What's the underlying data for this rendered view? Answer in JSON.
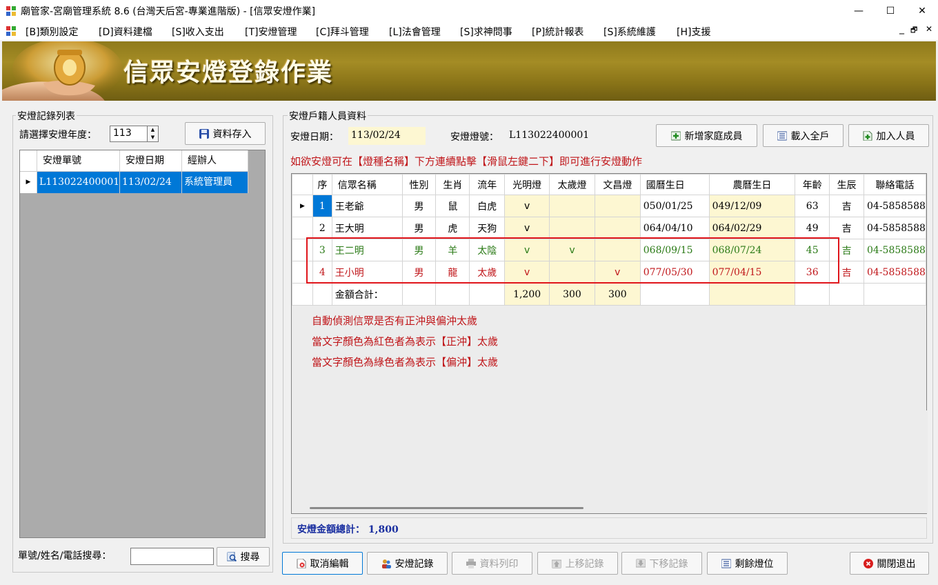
{
  "window": {
    "title": "廟管家-宮廟管理系統 8.6 (台灣天后宮-專業進階版) - [信眾安燈作業]",
    "minimize": "—",
    "maximize": "☐",
    "close": "✕"
  },
  "menu": {
    "items": [
      "[B]類別設定",
      "[D]資料建檔",
      "[S]收入支出",
      "[T]安燈管理",
      "[C]拜斗管理",
      "[L]法會管理",
      "[S]求神問事",
      "[P]統計報表",
      "[S]系統維護",
      "[H]支援"
    ],
    "mdi_minimize": "_",
    "mdi_restore": "🗗",
    "mdi_close": "✕"
  },
  "banner": {
    "title": "信眾安燈登錄作業"
  },
  "left": {
    "group_label": "安燈記錄列表",
    "year_label": "請選擇安燈年度：",
    "year_value": "113",
    "save_button": "資料存入",
    "grid": {
      "columns": [
        "安燈單號",
        "安燈日期",
        "經辦人"
      ],
      "rows": [
        {
          "no": "L113022400001",
          "date": "113/02/24",
          "handler": "系統管理員"
        }
      ]
    },
    "search_label": "單號/姓名/電話搜尋：",
    "search_value": "",
    "search_button": "搜尋"
  },
  "right": {
    "group_label": "安燈戶籍人員資料",
    "date_label": "安燈日期：",
    "date_value": "113/02/24",
    "lamp_no_label": "安燈燈號：",
    "lamp_no_value": "L113022400001",
    "buttons": {
      "add_family": "新增家庭成員",
      "load_all": "載入全戶",
      "add_person": "加入人員"
    },
    "instruction": "如欲安燈可在【燈種名稱】下方連續點擊【滑鼠左鍵二下】即可進行安燈動作",
    "grid": {
      "columns": [
        "序",
        "信眾名稱",
        "性別",
        "生肖",
        "流年",
        "光明燈",
        "太歲燈",
        "文昌燈",
        "國曆生日",
        "農曆生日",
        "年齡",
        "生辰",
        "聯絡電話"
      ],
      "rows": [
        {
          "seq": "1",
          "name": "王老爺",
          "gender": "男",
          "zodiac": "鼠",
          "year": "白虎",
          "l1": "v",
          "l2": "",
          "l3": "",
          "solar": "050/01/25",
          "lunar": "049/12/09",
          "age": "63",
          "hour": "吉",
          "phone": "04-5858588",
          "color": "normal"
        },
        {
          "seq": "2",
          "name": "王大明",
          "gender": "男",
          "zodiac": "虎",
          "year": "天狗",
          "l1": "v",
          "l2": "",
          "l3": "",
          "solar": "064/04/10",
          "lunar": "064/02/29",
          "age": "49",
          "hour": "吉",
          "phone": "04-5858588",
          "color": "normal"
        },
        {
          "seq": "3",
          "name": "王二明",
          "gender": "男",
          "zodiac": "羊",
          "year": "太陰",
          "l1": "v",
          "l2": "v",
          "l3": "",
          "solar": "068/09/15",
          "lunar": "068/07/24",
          "age": "45",
          "hour": "吉",
          "phone": "04-5858588",
          "color": "green"
        },
        {
          "seq": "4",
          "name": "王小明",
          "gender": "男",
          "zodiac": "龍",
          "year": "太歲",
          "l1": "v",
          "l2": "",
          "l3": "v",
          "solar": "077/05/30",
          "lunar": "077/04/15",
          "age": "36",
          "hour": "吉",
          "phone": "04-5858588",
          "color": "red"
        }
      ],
      "total_label": "金額合計：",
      "total_l1": "1,200",
      "total_l2": "300",
      "total_l3": "300"
    },
    "notes": [
      "自動偵測信眾是否有正沖與偏沖太歲",
      "當文字顏色為紅色者為表示【正沖】太歲",
      "當文字顏色為綠色者為表示【偏沖】太歲"
    ],
    "total_amount": "安燈金額總計： 1,800"
  },
  "bottom_buttons": {
    "cancel_edit": "取消編輯",
    "lamp_record": "安燈記錄",
    "print": "資料列印",
    "move_up": "上移記錄",
    "move_down": "下移記錄",
    "remaining": "剩餘燈位",
    "exit": "關閉退出"
  },
  "colors": {
    "selection": "#0078d7",
    "highlight_cell": "#fdf7d2",
    "red_text": "#c0161a",
    "green_text": "#2a7a16",
    "total_blue": "#1a2fa0"
  }
}
